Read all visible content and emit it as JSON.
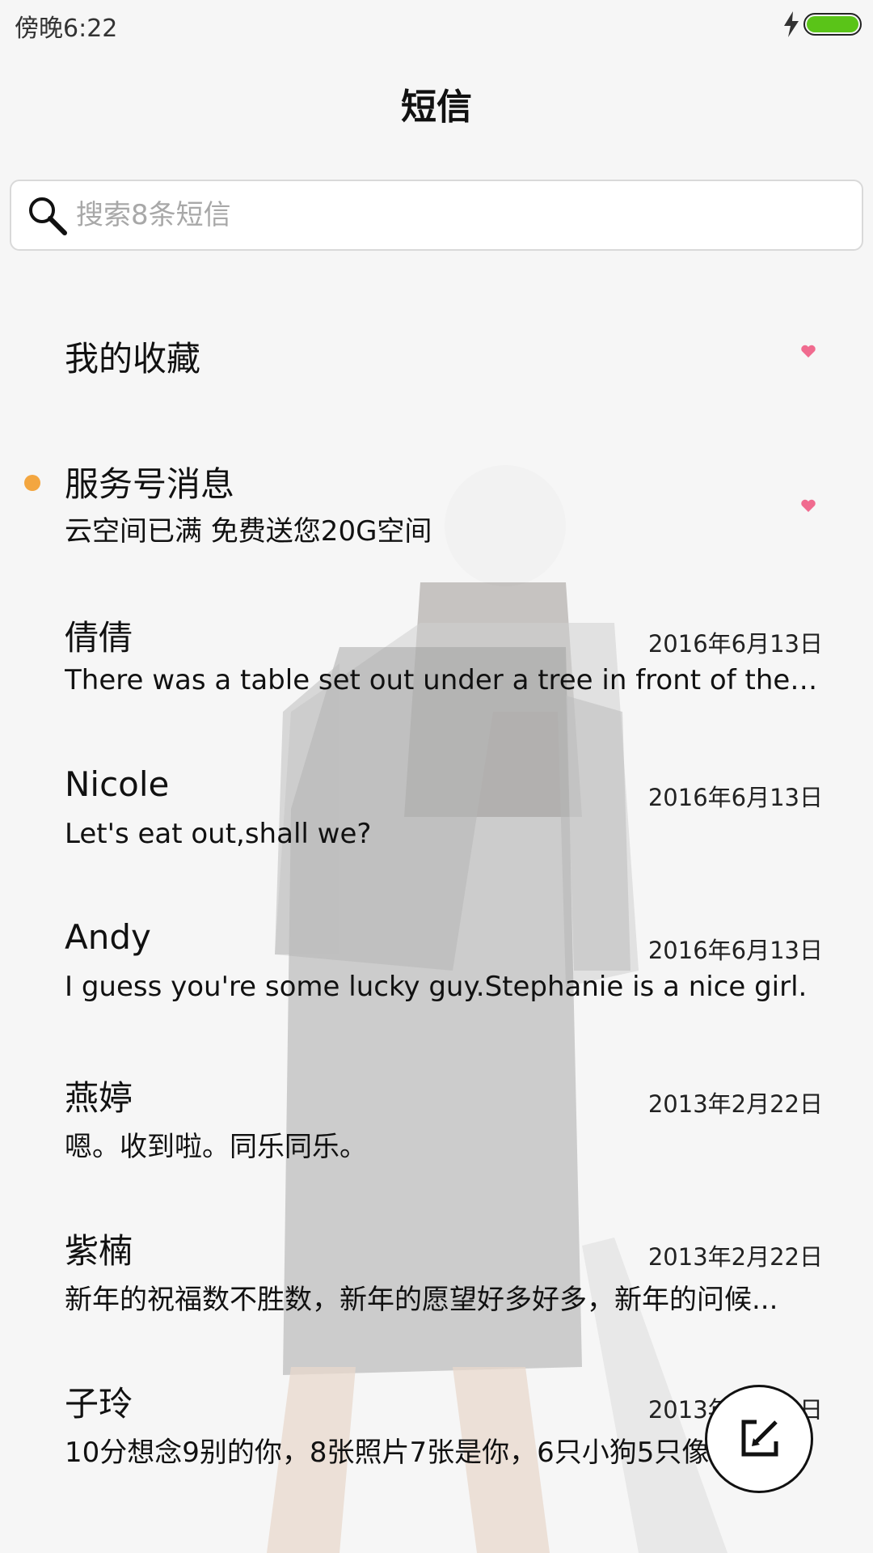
{
  "status_bar": {
    "time": "傍晚6:22",
    "charging_icon": "charging-bolt-icon",
    "battery_icon": "battery-icon",
    "battery_level": 1.0,
    "battery_color": "#5ac418"
  },
  "header": {
    "title": "短信"
  },
  "search": {
    "placeholder": "搜索8条短信",
    "value": ""
  },
  "favorites": {
    "label": "我的收藏",
    "icon": "heart-icon"
  },
  "service": {
    "name": "服务号消息",
    "snippet": "云空间已满 免费送您20G空间",
    "unread": true,
    "unread_color": "#f3a640",
    "icon": "heart-icon"
  },
  "conversations": [
    {
      "name": "倩倩",
      "date": "2016年6月13日",
      "snippet": "There was a table set out under a tree in front of the ho..."
    },
    {
      "name": "Nicole",
      "date": "2016年6月13日",
      "snippet": "Let's eat out,shall we?"
    },
    {
      "name": "Andy",
      "date": "2016年6月13日",
      "snippet": "I guess you're some lucky guy.Stephanie is a nice girl."
    },
    {
      "name": "燕婷",
      "date": "2013年2月22日",
      "snippet": "嗯。收到啦。同乐同乐。"
    },
    {
      "name": "紫楠",
      "date": "2013年2月22日",
      "snippet": "新年的祝福数不胜数，新年的愿望好多好多，新年的问候..."
    },
    {
      "name": "子玲",
      "date": "2013年2月22日",
      "snippet": "10分想念9别的你，8张照片7张是你，6只小狗5只像..."
    }
  ],
  "fab": {
    "icon": "compose-icon"
  },
  "colors": {
    "heart": "#f06b8f",
    "background": "#f6f6f6"
  }
}
